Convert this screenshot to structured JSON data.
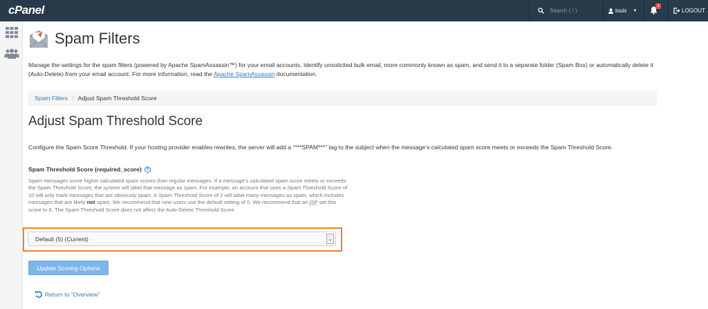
{
  "topbar": {
    "logo": "cPanel",
    "search_placeholder": "Search ( / )",
    "user": "louis",
    "notification_count": "1",
    "logout": "LOGOUT"
  },
  "page": {
    "title": "Spam Filters",
    "intro_1": "Manage the settings for the spam filters (powered by Apache SpamAssassin™) for your email accounts. Identify unsolicited bulk email, more commonly known as spam, and send it to a separate folder (Spam Box) or automatically delete it (Auto-Delete) from your email account. For more information, read the ",
    "intro_link": "Apache SpamAssassin",
    "intro_2": " documentation."
  },
  "breadcrumb": {
    "parent": "Spam Filters",
    "current": "Adjust Spam Threshold Score"
  },
  "section": {
    "title": "Adjust Spam Threshold Score",
    "configure": "Configure the Spam Score Threshold. If your hosting provider enables rewrites, the server will add a “***SPAM***” tag to the subject when the message’s calculated spam score meets or exceeds the Spam Threshold Score.",
    "field_label": "Spam Threshold Score (required_score)",
    "help_1": "Spam messages score higher calculated spam scores than regular messages. If a message’s calculated spam score meets or exceeds the Spam Threshold Score, the system will label that message as spam. For example, an account that uses a Spam Threshold Score of 10 will only mark messages that are obviously spam. A Spam Threshold Score of 2 will label many messages as spam, which includes messages that are likely ",
    "help_bold": "not",
    "help_2": " spam. We recommend that new users use the default setting of 5. We recommend that an ",
    "help_isp": "ISP",
    "help_3": " set this score to 8. The Spam Threshold Score does not affect the Auto-Delete Threshold Score.",
    "select_value": "Default (5) (Current)",
    "submit": "Update Scoring Options",
    "return_link": "Return to “Overview”"
  },
  "colors": {
    "topbar": "#293a4a",
    "link": "#2a7bbf",
    "highlight": "#f47c20",
    "button": "#7eb6e8"
  }
}
